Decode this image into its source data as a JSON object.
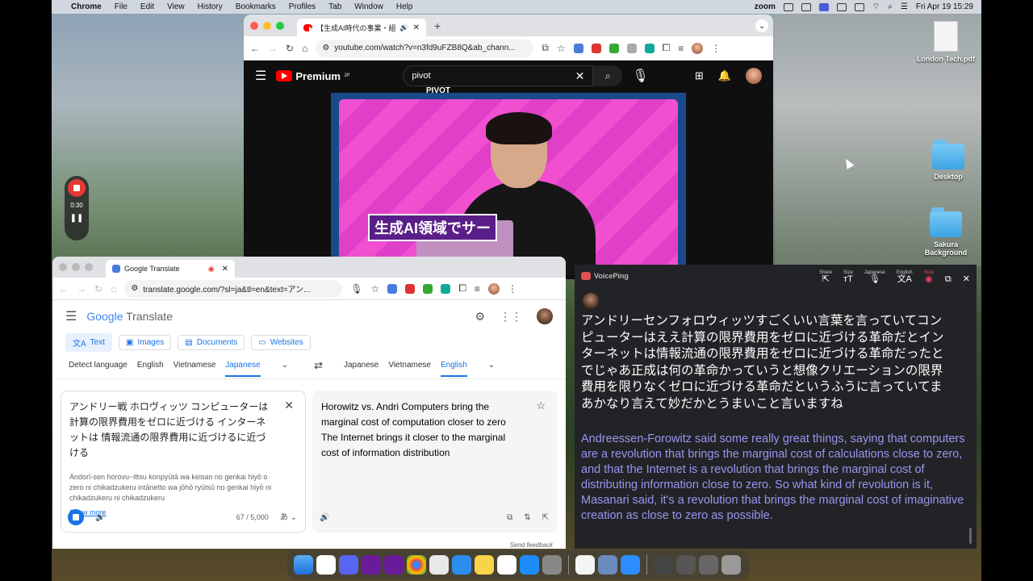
{
  "menubar": {
    "app": "Chrome",
    "items": [
      "File",
      "Edit",
      "View",
      "History",
      "Bookmarks",
      "Profiles",
      "Tab",
      "Window",
      "Help"
    ],
    "zoom_label": "zoom",
    "datetime": "Fri Apr 19  15:29"
  },
  "desktop": {
    "icons": [
      {
        "label": "London Tech.pdf"
      },
      {
        "label": "Desktop"
      },
      {
        "label": "Sakura Background"
      }
    ]
  },
  "recorder": {
    "time": "0:30",
    "pause": "❚❚"
  },
  "youtube_window": {
    "tab_title": "【生成AI時代の事業・組織づ",
    "url": "youtube.com/watch?v=n3fd9uFZB8Q&ab_chann...",
    "logo": "Premium",
    "logo_region": "JP",
    "search_value": "pivot",
    "video_caption": "生成AI領域でサー",
    "channel_mark": "PIVOT"
  },
  "translate_window": {
    "tab_title": "Google Translate",
    "url": "translate.google.com/?sl=ja&tl=en&text=アン...",
    "logo_google": "Google",
    "logo_translate": "Translate",
    "modes": [
      "Text",
      "Images",
      "Documents",
      "Websites"
    ],
    "source_langs": [
      "Detect language",
      "English",
      "Vietnamese",
      "Japanese"
    ],
    "target_langs": [
      "Japanese",
      "Vietnamese",
      "English"
    ],
    "source_text": "アンドリー戦 ホロヴィッツ コンピューターは計算の限界費用をゼロに近づける インターネットは 情報流通の限界費用に近づけるに近づける",
    "transliteration": "Andorī-sen horovu~ittsu konpyūtā wa keisan no genkai hiyō o zero ni chikadzukeru intānetto wa jōhō ryūtsū no genkai hiyō ni chikadzukeru ni chikadzukeru",
    "show_more": "Show more",
    "counter": "67 / 5,000",
    "output_text": "Horowitz vs. Andri Computers bring the marginal cost of computation closer to zero The Internet brings it closer to the marginal cost of information distribution",
    "feedback": "Send feedback"
  },
  "voiceping": {
    "logo": "VoicePing",
    "tools": [
      {
        "label": "Share",
        "icon": "⇱"
      },
      {
        "label": "Size",
        "icon": "ᴛT"
      },
      {
        "label": "Japanese",
        "icon": "🎙"
      },
      {
        "label": "English",
        "icon": "文A"
      },
      {
        "label": "Stop",
        "icon": "◉"
      }
    ],
    "japanese_text": "アンドリーセンフォロウィッツすごくいい言葉を言っていてコンピューターはええ計算の限界費用をゼロに近づける革命だとインターネットは情報流通の限界費用をゼロに近づける革命だったとでじゃあ正成は何の革命かっていうと想像クリエーションの限界費用を限りなくゼロに近づける革命だというふうに言っていてまあかなり言えて妙だかとうまいこと言いますね",
    "english_text": "Andreessen-Forowitz said some really great things, saying that computers are a revolution that brings the marginal cost of calculations close to zero, and that the Internet is a revolution that brings the marginal cost of distributing information close to zero. So what kind of revolution is it, Masanari said, it's a revolution that brings the marginal cost of imaginative creation as close to zero as possible."
  },
  "colors": {
    "youtube_red": "#ff0000",
    "google_blue": "#1a73e8",
    "voiceping_english": "#9b94f0",
    "stop_red": "#ff3b5c"
  }
}
